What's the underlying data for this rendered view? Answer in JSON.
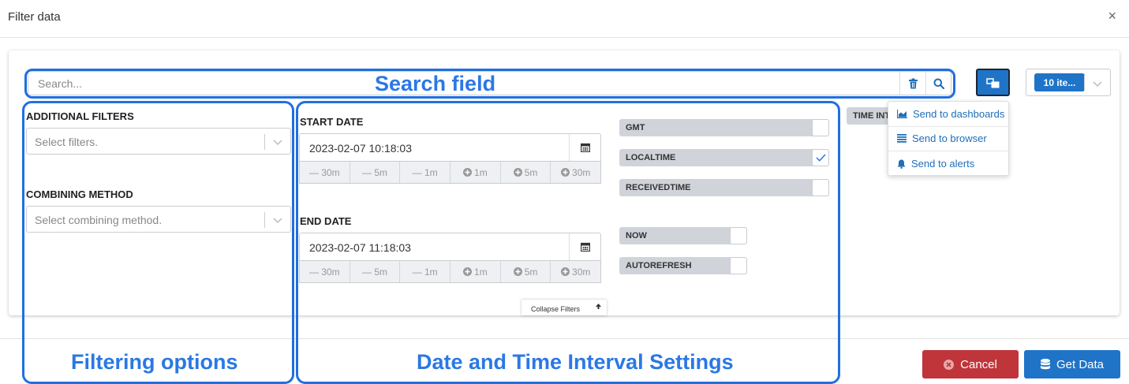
{
  "dialog": {
    "title": "Filter data",
    "close_glyph": "×"
  },
  "search": {
    "placeholder": "Search..."
  },
  "additional_filters": {
    "label": "ADDITIONAL FILTERS",
    "placeholder": "Select filters."
  },
  "combining_method": {
    "label": "COMBINING METHOD",
    "placeholder": "Select combining method."
  },
  "start_date": {
    "label": "START DATE",
    "value": "2023-02-07 10:18:03",
    "offsets": [
      "— 30m",
      "— 5m",
      "— 1m",
      "1m",
      "5m",
      "30m"
    ]
  },
  "end_date": {
    "label": "END DATE",
    "value": "2023-02-07 11:18:03",
    "offsets": [
      "— 30m",
      "— 5m",
      "— 1m",
      "1m",
      "5m",
      "30m"
    ]
  },
  "toggles": {
    "gmt": {
      "label": "GMT",
      "checked": false
    },
    "localtime": {
      "label": "LOCALTIME",
      "checked": true
    },
    "receivedtime": {
      "label": "RECEIVEDTIME",
      "checked": false
    },
    "now": {
      "label": "NOW",
      "checked": false
    },
    "autorefresh": {
      "label": "AUTOREFRESH",
      "checked": false
    }
  },
  "time_interval": {
    "label": "TIME INT"
  },
  "items_select": {
    "value": "10 ite..."
  },
  "send_menu": {
    "items": [
      {
        "label": "Send to dashboards",
        "icon": "chart-area-icon"
      },
      {
        "label": "Send to browser",
        "icon": "list-icon"
      },
      {
        "label": "Send to alerts",
        "icon": "bell-icon"
      }
    ]
  },
  "collapse_filters": {
    "label": "Collapse Filters"
  },
  "footer": {
    "cancel_label": "Cancel",
    "get_data_label": "Get Data"
  },
  "annotations": {
    "search_field": "Search field",
    "filtering_options": "Filtering options",
    "date_time": "Date and Time Interval Settings"
  },
  "colors": {
    "primary": "#1f74c8",
    "danger": "#c0353a",
    "annotation": "#2a78e4",
    "link": "#1f6fb8"
  }
}
